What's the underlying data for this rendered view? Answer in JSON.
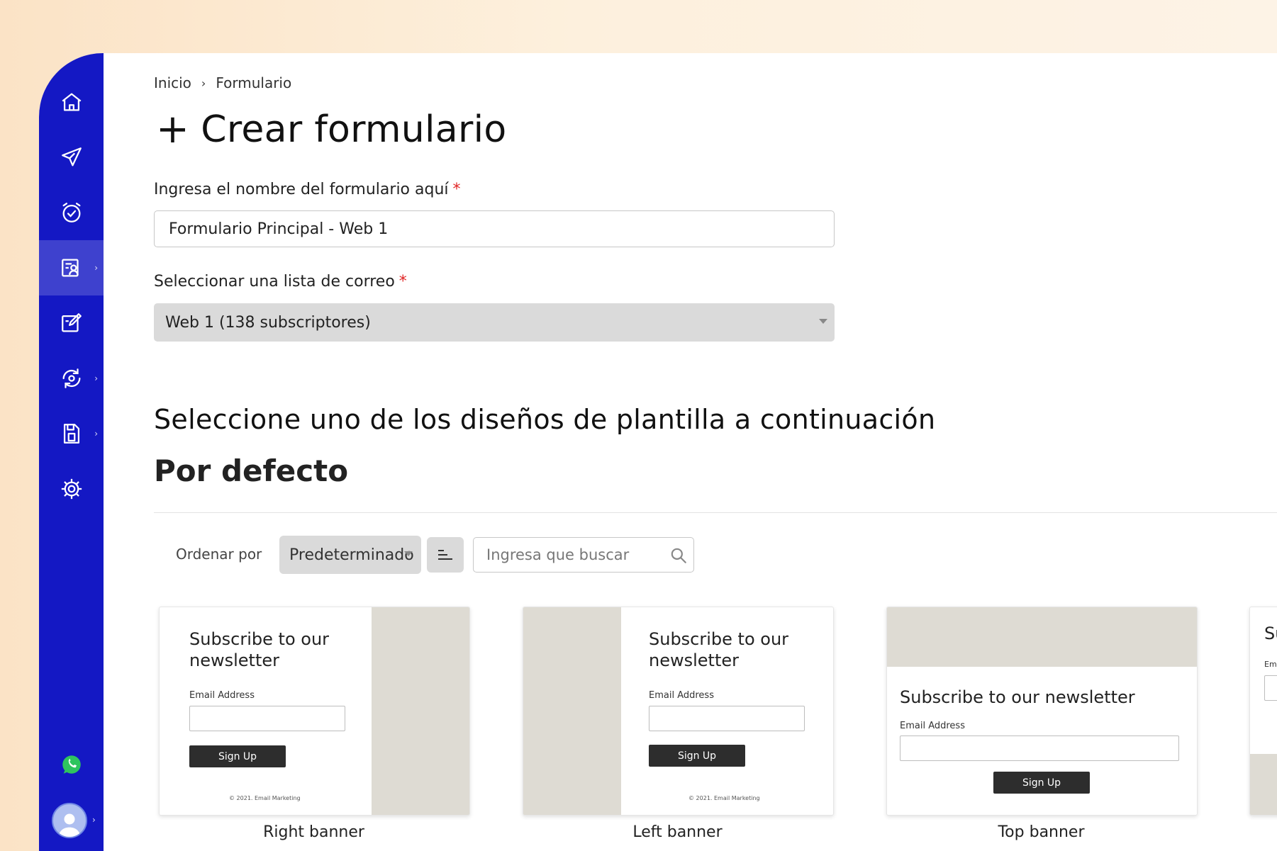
{
  "sidebar": {
    "items": [
      {
        "icon": "home-icon"
      },
      {
        "icon": "send-icon"
      },
      {
        "icon": "alarm-check-icon"
      },
      {
        "icon": "form-user-icon",
        "active": true
      },
      {
        "icon": "edit-square-icon"
      },
      {
        "icon": "sync-icon"
      },
      {
        "icon": "save-document-icon"
      },
      {
        "icon": "settings-gear-icon"
      }
    ],
    "support_icon": "whatsapp-icon",
    "avatar_icon": "user-avatar-icon",
    "chevron": "›"
  },
  "breadcrumb": {
    "items": [
      "Inicio",
      "Formulario"
    ],
    "separator": "›"
  },
  "page": {
    "title_prefix": "+",
    "title": "Crear formulario"
  },
  "form": {
    "name_label": "Ingresa el nombre del formulario aquí",
    "required_mark": "*",
    "name_value": "Formulario Principal - Web 1",
    "list_label": "Seleccionar una lista de correo",
    "list_value": "Web 1 (138 subscriptores)"
  },
  "templates": {
    "section_title": "Seleccione uno de los diseños de plantilla a continuación",
    "group_title": "Por defecto",
    "sort_label": "Ordenar por",
    "sort_value": "Predeterminado",
    "search_placeholder": "Ingresa que buscar",
    "cards": [
      {
        "name": "Right banner",
        "title": "Subscribe to our newsletter",
        "email_label": "Email Address",
        "button": "Sign Up",
        "footer": "© 2021. Email Marketing"
      },
      {
        "name": "Left banner",
        "title": "Subscribe to our newsletter",
        "email_label": "Email Address",
        "button": "Sign Up",
        "footer": "© 2021. Email Marketing"
      },
      {
        "name": "Top banner",
        "title": "Subscribe to our newsletter",
        "email_label": "Email Address",
        "button": "Sign Up"
      },
      {
        "title_partial": "Su",
        "email_partial": "Em"
      }
    ]
  },
  "colors": {
    "sidebar": "#1418c4",
    "banner": "#dedbd3",
    "button": "#2d2d2d",
    "required": "#e02424"
  }
}
